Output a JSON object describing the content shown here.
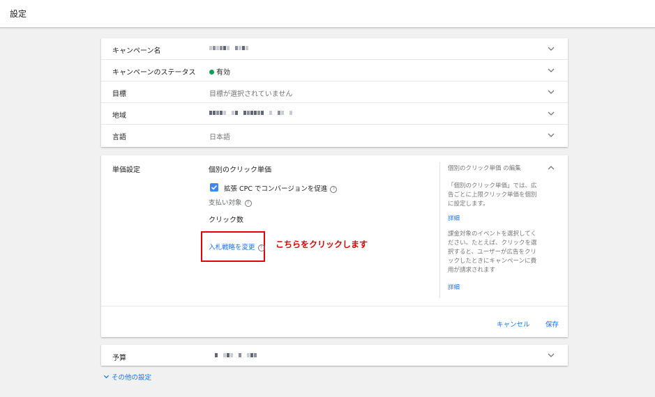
{
  "header": {
    "title": "設定"
  },
  "settings_rows": [
    {
      "label": "キャンペーン名",
      "value": ""
    },
    {
      "label": "キャンペーンのステータス",
      "value": "有効"
    },
    {
      "label": "目標",
      "value": "目標が選択されていません"
    },
    {
      "label": "地域",
      "value": ""
    },
    {
      "label": "言語",
      "value": "日本語"
    }
  ],
  "bidding": {
    "label": "単価設定",
    "strategy": "個別のクリック単価",
    "enhanced_cpc_label": "拡張 CPC でコンバージョンを促進",
    "enhanced_cpc_checked": true,
    "pay_for_label": "支払い対象",
    "pay_for_value": "クリック数",
    "change_strategy_link": "入札戦略を変更",
    "annotation": "こちらをクリックします"
  },
  "side_panel": {
    "title": "個別のクリック単価 の編集",
    "help1": "「個別のクリック単価」では、広告ごとに上限クリック単価を個別に設定します。",
    "link1": "詳細",
    "help2": "課金対象のイベントを選択してください。たとえば、クリックを選択すると、ユーザーが広告をクリックしたときにキャンペーンに費用が請求されます",
    "link2": "詳細"
  },
  "actions": {
    "cancel": "キャンセル",
    "save": "保存"
  },
  "budget": {
    "label": "予算"
  },
  "other_settings": "その他の設定",
  "colors": {
    "accent": "#1a73e8",
    "status_active": "#0f9d58",
    "highlight": "#e00000",
    "checkbox": "#4285f4"
  },
  "icons": [
    "chevron-down-icon",
    "chevron-up-icon",
    "help-icon",
    "check-icon"
  ]
}
